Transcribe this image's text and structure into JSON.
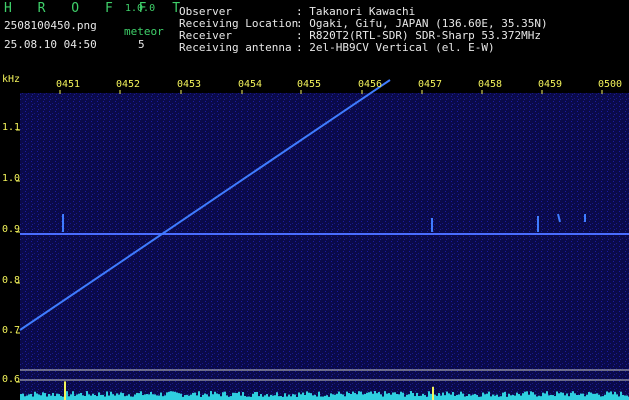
{
  "app": {
    "title": "H R O F F T",
    "version": "1.0.0",
    "filename": "2508100450.png",
    "datetime": "25.08.10 04:50",
    "meteor_label": "meteor",
    "meteor_count": "5"
  },
  "info": {
    "observer_label": "Observer",
    "observer_value": ": Takanori Kawachi",
    "location_label": "Receiving Location",
    "location_value": ": Ogaki, Gifu, JAPAN (136.60E, 35.35N)",
    "receiver_label": "Receiver",
    "receiver_value": ": R820T2(RTL-SDR) SDR-Sharp 53.372MHz",
    "antenna_label": "Receiving antenna",
    "antenna_value": ": 2el-HB9CV Vertical (el. E-W)"
  },
  "axis": {
    "unit": "kHz",
    "y_ticks": [
      "1.1",
      "1.0",
      "0.9",
      "0.8",
      "0.7",
      "0.6"
    ],
    "x_ticks": [
      "0451",
      "0452",
      "0453",
      "0454",
      "0455",
      "0456",
      "0457",
      "0458",
      "0459",
      "0500"
    ]
  },
  "colors": {
    "background": "#000000",
    "spectrum": "#0b0b55",
    "trace": "#3f7cff",
    "carrier": "#4a6dff",
    "labels_green": "#3fd06a",
    "labels_yellow": "#f2f25a",
    "bottom_bar": "#2fd0e0"
  }
}
